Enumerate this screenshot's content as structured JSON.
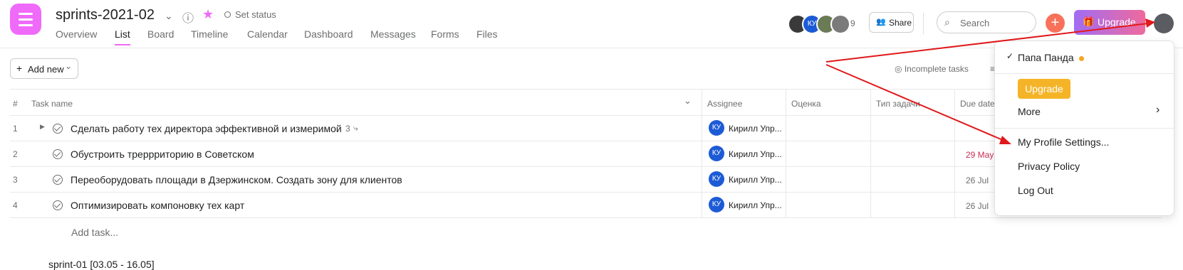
{
  "header": {
    "project_title": "sprints-2021-02",
    "set_status": "Set status",
    "tabs": [
      "Overview",
      "List",
      "Board",
      "Timeline",
      "Calendar",
      "Dashboard",
      "Messages",
      "Forms",
      "Files"
    ],
    "active_tab": "List",
    "member_count": "9",
    "share_label": "Share",
    "search_placeholder": "Search",
    "upgrade_label": "Upgrade",
    "avatar_initials": "КУ"
  },
  "toolbar": {
    "add_new_label": "Add new",
    "incomplete_label": "Incomplete tasks"
  },
  "table": {
    "headers": {
      "num": "#",
      "task": "Task name",
      "assignee": "Assignee",
      "score": "Оценка",
      "type": "Тип задачи",
      "due": "Due date"
    },
    "rows": [
      {
        "n": "1",
        "name": "Сделать работу тех директора эффективной и измеримой",
        "subtasks": "3",
        "initials": "КУ",
        "assignee": "Кирилл Упр...",
        "due": ""
      },
      {
        "n": "2",
        "name": "Обустроить треррриторию в Советском",
        "initials": "КУ",
        "assignee": "Кирилл Упр...",
        "due": "29 May"
      },
      {
        "n": "3",
        "name": "Переоборудовать площади в Дзержинском. Создать зону для клиентов",
        "initials": "КУ",
        "assignee": "Кирилл Упр...",
        "due": "26 Jul"
      },
      {
        "n": "4",
        "name": "Оптимизировать компоновку тех карт",
        "initials": "КУ",
        "assignee": "Кирилл Упр...",
        "due": "26 Jul"
      }
    ],
    "add_task": "Add task...",
    "next_section": "sprint-01 [03.05 - 16.05]"
  },
  "menu": {
    "user_name": "Папа Панда",
    "upgrade": "Upgrade",
    "more": "More",
    "profile_settings": "My Profile Settings...",
    "privacy": "Privacy Policy",
    "logout": "Log Out"
  },
  "colors": {
    "brand_pink": "#f06af9",
    "upgrade_yellow": "#f5b427",
    "overdue_red": "#c92f54",
    "annotation_red": "#e0191b"
  }
}
